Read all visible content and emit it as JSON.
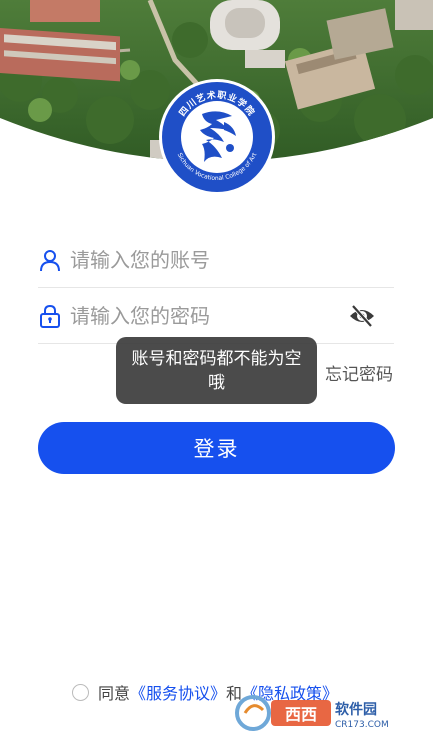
{
  "login": {
    "account_placeholder": "请输入您的账号",
    "password_placeholder": "请输入您的密码",
    "forgot_label": "忘记密码",
    "submit_label": "登录"
  },
  "toast": {
    "message": "账号和密码都不能为空哦"
  },
  "agreement": {
    "prefix": "同意",
    "service_link": "《服务协议》",
    "conjunction": "和",
    "privacy_link": "《隐私政策》"
  },
  "logo": {
    "ring_text": "四川艺术职业学院",
    "en_text": "Sichuan Vocational College of Art"
  },
  "watermark": {
    "brand": "西西软件园",
    "url": "CR173.COM"
  },
  "icons": {
    "account": "user-icon",
    "password": "lock-icon",
    "visibility": "eye-off-icon",
    "agree": "radio-unchecked-icon"
  },
  "colors": {
    "primary": "#1650ee",
    "toast_bg": "#3c3c3c",
    "logo_blue": "#1f4fc7"
  }
}
